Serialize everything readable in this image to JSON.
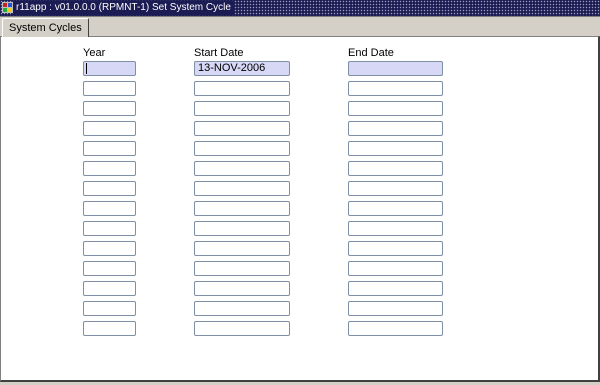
{
  "window": {
    "title": "r11app : v01.0.0.0 (RPMNT-1) Set System Cycle",
    "icon": "oracle-app-icon"
  },
  "tabs": [
    {
      "label": "System Cycles"
    }
  ],
  "table": {
    "columns": {
      "year": "Year",
      "start_date": "Start Date",
      "end_date": "End Date"
    },
    "rows": [
      {
        "year": "",
        "start_date": "13-NOV-2006",
        "end_date": ""
      },
      {
        "year": "",
        "start_date": "",
        "end_date": ""
      },
      {
        "year": "",
        "start_date": "",
        "end_date": ""
      },
      {
        "year": "",
        "start_date": "",
        "end_date": ""
      },
      {
        "year": "",
        "start_date": "",
        "end_date": ""
      },
      {
        "year": "",
        "start_date": "",
        "end_date": ""
      },
      {
        "year": "",
        "start_date": "",
        "end_date": ""
      },
      {
        "year": "",
        "start_date": "",
        "end_date": ""
      },
      {
        "year": "",
        "start_date": "",
        "end_date": ""
      },
      {
        "year": "",
        "start_date": "",
        "end_date": ""
      },
      {
        "year": "",
        "start_date": "",
        "end_date": ""
      },
      {
        "year": "",
        "start_date": "",
        "end_date": ""
      },
      {
        "year": "",
        "start_date": "",
        "end_date": ""
      },
      {
        "year": "",
        "start_date": "",
        "end_date": ""
      }
    ]
  },
  "colors": {
    "current_record": "#d7d7f6",
    "field_border": "#7f8fa6",
    "window_background": "#d4d0c8"
  }
}
